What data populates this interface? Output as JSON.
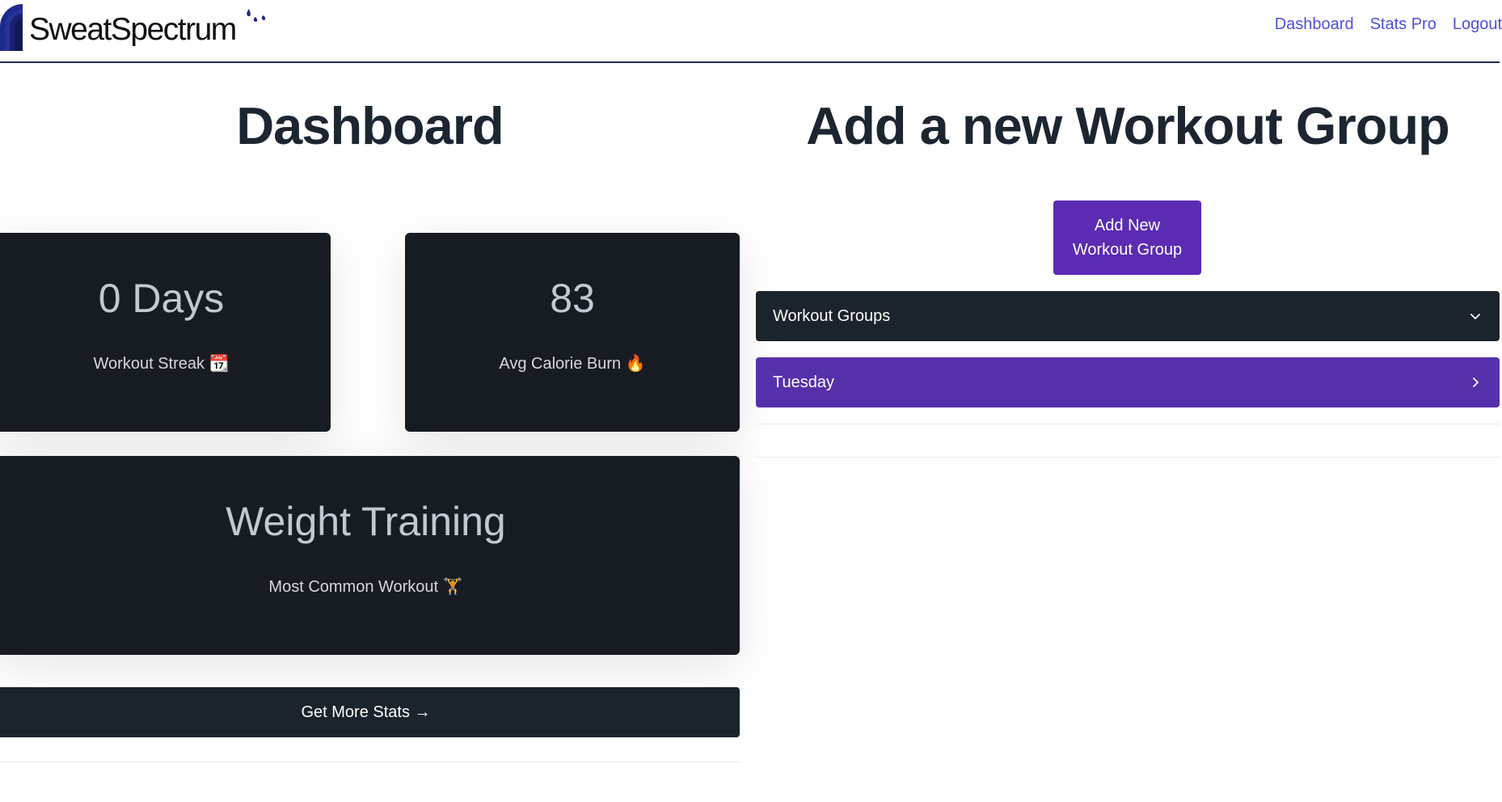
{
  "brand": {
    "name": "SweatSpectrum"
  },
  "nav": {
    "links": [
      "Dashboard",
      "Stats Pro",
      "Logout"
    ]
  },
  "dashboard": {
    "title": "Dashboard",
    "stats": [
      {
        "value": "0 Days",
        "label": "Workout Streak 📆"
      },
      {
        "value": "83",
        "label": "Avg Calorie Burn 🔥"
      },
      {
        "value": "Weight Training",
        "label": "Most Common Workout 🏋️"
      }
    ],
    "more_stats_label": "Get More Stats →"
  },
  "workout_groups": {
    "title": "Add a new Workout Group",
    "add_button": {
      "line1": "Add New",
      "line2": "Workout Group"
    },
    "accordion_header": "Workout Groups",
    "items": [
      "Tuesday"
    ]
  },
  "colors": {
    "primary_purple": "#5b2bb3",
    "dark": "#171c23",
    "nav_link": "#4f4fd8"
  }
}
